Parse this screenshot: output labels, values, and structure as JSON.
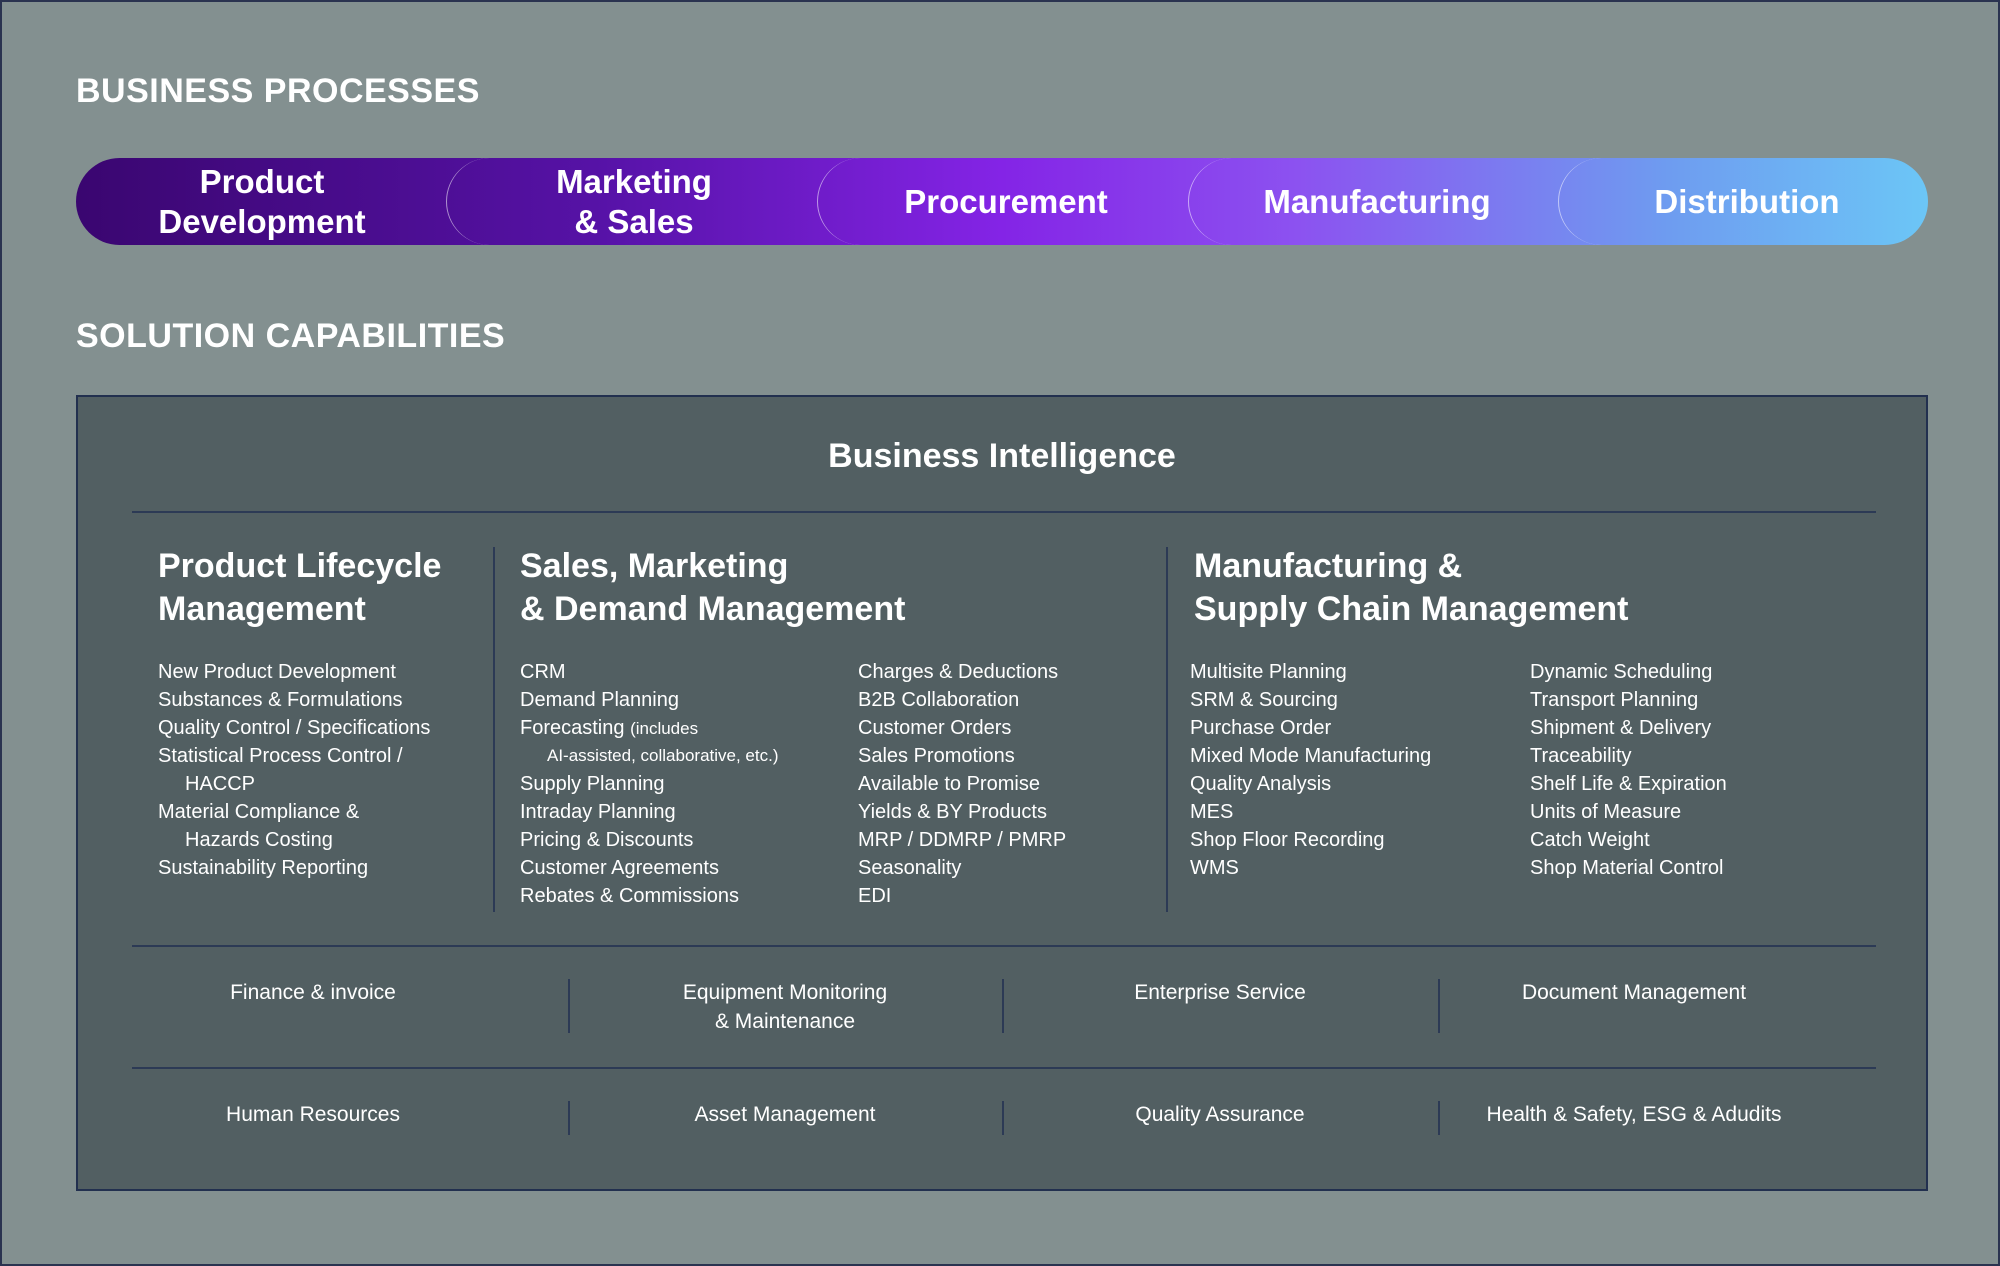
{
  "sections": {
    "processes_title": "BUSINESS PROCESSES",
    "capabilities_title": "SOLUTION CAPABILITIES"
  },
  "processes": [
    {
      "label": "Product\nDevelopment"
    },
    {
      "label": "Marketing\n& Sales"
    },
    {
      "label": "Procurement"
    },
    {
      "label": "Manufacturing"
    },
    {
      "label": "Distribution"
    }
  ],
  "capabilities": {
    "top_title": "Business Intelligence",
    "columns": {
      "plm": {
        "title": "Product Lifecycle\nManagement",
        "items": [
          "New Product Development",
          "Substances & Formulations",
          "Quality Control / Specifications",
          "Statistical Process Control /",
          "HACCP",
          "Material Compliance &",
          "Hazards Costing",
          "Sustainability Reporting"
        ]
      },
      "sales": {
        "title": "Sales, Marketing\n& Demand Management",
        "items_left": [
          "CRM",
          "Demand Planning",
          "Forecasting",
          "AI-assisted, collaborative, etc.)",
          "Supply Planning",
          "Intraday Planning",
          "Pricing & Discounts",
          "Customer Agreements",
          "Rebates & Commissions"
        ],
        "forecasting_note": "(includes",
        "items_right": [
          "Charges & Deductions",
          "B2B Collaboration",
          "Customer Orders",
          "Sales Promotions",
          "Available to Promise",
          "Yields & BY Products",
          "MRP / DDMRP / PMRP",
          "Seasonality",
          "EDI"
        ]
      },
      "scm": {
        "title": "Manufacturing &\nSupply Chain Management",
        "items_left": [
          "Multisite Planning",
          "SRM & Sourcing",
          "Purchase Order",
          "Mixed Mode Manufacturing",
          "Quality Analysis",
          "MES",
          "Shop Floor Recording",
          "WMS"
        ],
        "items_right": [
          "Dynamic Scheduling",
          "Transport Planning",
          "Shipment & Delivery",
          "Traceability",
          "Shelf Life & Expiration",
          "Units of Measure",
          "Catch Weight",
          "Shop Material Control"
        ]
      }
    },
    "row1": [
      "Finance & invoice",
      "Equipment Monitoring\n& Maintenance",
      "Enterprise Service",
      "Document Management"
    ],
    "row2": [
      "Human Resources",
      "Asset Management",
      "Quality Assurance",
      "Health & Safety, ESG & Adudits"
    ]
  }
}
